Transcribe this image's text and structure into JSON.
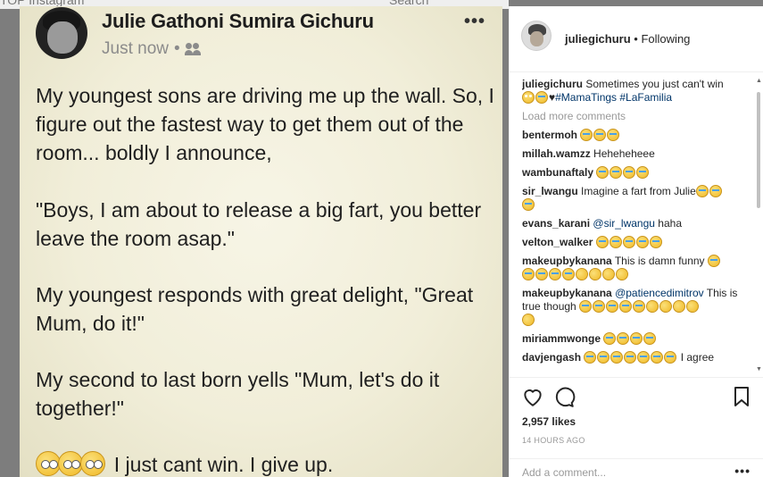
{
  "top_strip": {
    "text_left": "TOP    Instagram",
    "text_right": "Search"
  },
  "post_image": {
    "author": "Julie Gathoni Sumira Gichuru",
    "timestamp": "Just now",
    "separator": "•",
    "more": "•••",
    "paragraphs": [
      "My youngest sons are driving me up the wall. So, I figure out the fastest way to get them out of the room... boldly I announce,",
      "\"Boys, I am about to release a big fart, you better leave the room asap.\"",
      "My youngest responds with great delight, \"Great Mum, do it!\"",
      "My second to last born yells \"Mum, let's do it together!\""
    ],
    "closing": "I just cant win. I give up.",
    "icons": {
      "friends": "friends-icon",
      "emoji": "face-with-rolling-eyes-icon"
    }
  },
  "instagram": {
    "username": "juliegichuru",
    "follow_separator": "•",
    "follow_state": "Following",
    "caption": {
      "user": "juliegichuru",
      "text": "Sometimes you just can't win",
      "hashtags": "#MamaTings #LaFamilia"
    },
    "load_more": "Load more comments",
    "comments": [
      {
        "user": "bentermoh",
        "text": "",
        "mention": ""
      },
      {
        "user": "millah.wamzz",
        "text": "Heheheheee",
        "mention": ""
      },
      {
        "user": "wambunaftaly",
        "text": "",
        "mention": ""
      },
      {
        "user": "sir_lwangu",
        "text": "Imagine a fart from Julie",
        "mention": ""
      },
      {
        "user": "evans_karani",
        "text": "haha",
        "mention": "@sir_lwangu"
      },
      {
        "user": "velton_walker",
        "text": "",
        "mention": ""
      },
      {
        "user": "makeupbykanana",
        "text": "This is damn funny",
        "mention": ""
      },
      {
        "user": "makeupbykanana",
        "text": "This is true though",
        "mention": "@patiencedimitrov"
      },
      {
        "user": "miriammwonge",
        "text": "",
        "mention": ""
      },
      {
        "user": "davjengash",
        "text": "I agree",
        "mention": ""
      }
    ],
    "likes": "2,957 likes",
    "time": "14 HOURS AGO",
    "add_comment_placeholder": "Add a comment...",
    "add_more": "•••"
  },
  "colors": {
    "link": "#003569",
    "muted": "#999999",
    "text": "#262626",
    "post_bg": "#f1eed9"
  }
}
